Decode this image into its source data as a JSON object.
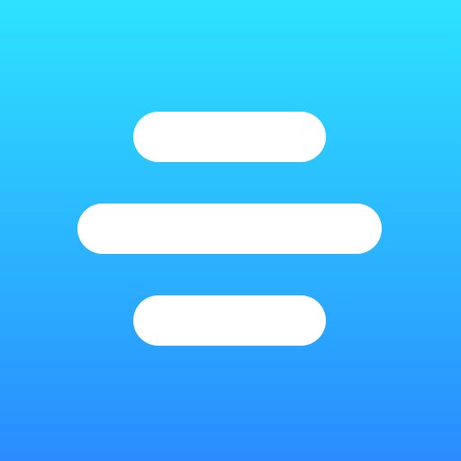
{
  "icon": {
    "name": "center-align-icon",
    "gradient_top": "#2ce3ff",
    "gradient_bottom": "#2a8cff",
    "bar_color": "#ffffff"
  }
}
